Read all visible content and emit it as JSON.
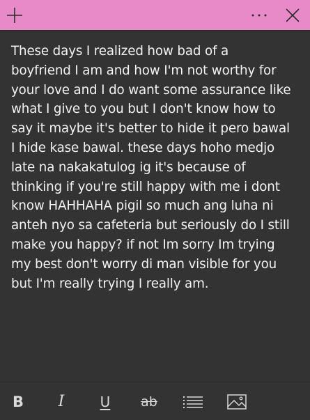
{
  "titlebar": {
    "background": "#e88ac8",
    "add_icon": "plus-icon",
    "menu_icon": "more-horizontal-icon",
    "close_icon": "close-icon"
  },
  "note": {
    "text": "These days I realized how bad of a\nboyfriend I am and how I'm not worthy for\nyour love and I do want some assurance like\nwhat I give to you but I don't know how to\nsay it maybe it's better to hide it pero bawal\nI hide kase bawal. these days hoho medjo\nlate na nakakatulog ig it's because of\nthinking if you're still happy with me i dont\nknow HAHHAHA pigil so much ang luha ni\nanteh nyo sa cafeteria but seriously do I still\nmake you happy? if not Im sorry Im trying\nmy best don't worry di man visible for you\nbut I'm really trying I really am."
  },
  "toolbar": {
    "bold_label": "B",
    "italic_label": "I",
    "underline_label": "U",
    "strike_label": "ab",
    "list_icon": "bullet-list-icon",
    "image_icon": "image-icon"
  }
}
